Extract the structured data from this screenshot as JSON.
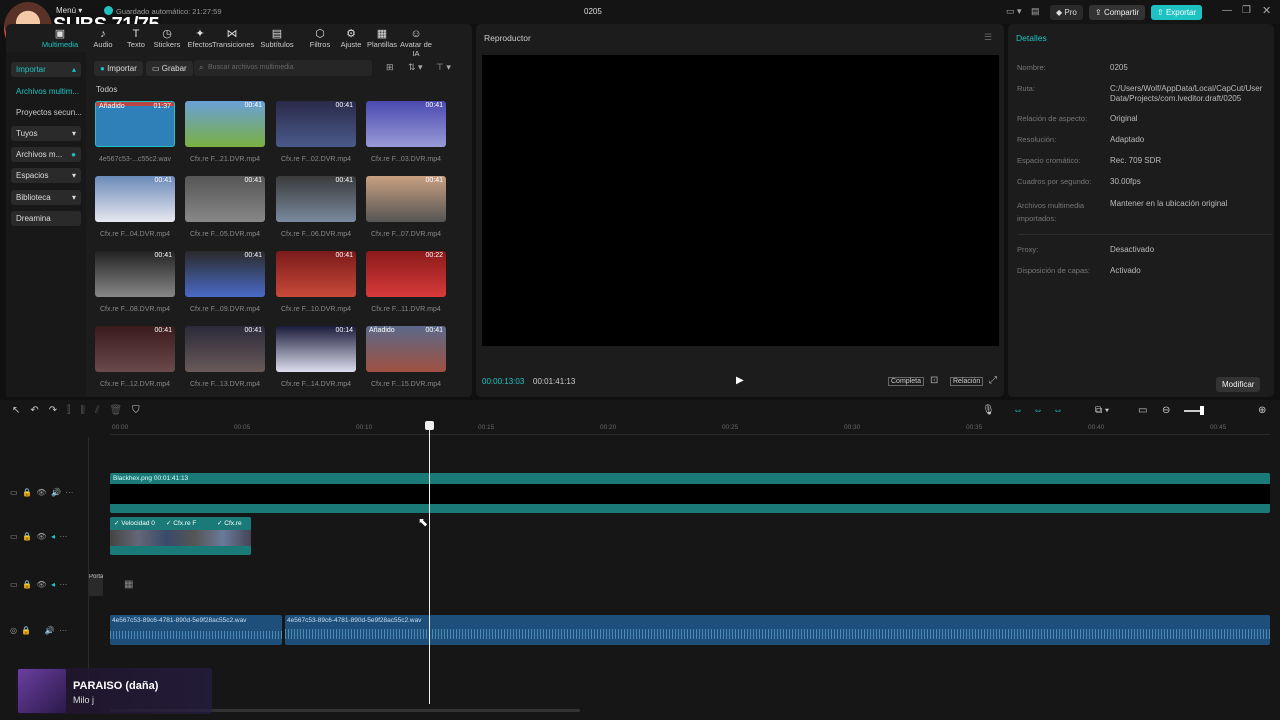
{
  "overlay": {
    "subs": "SUBS 71/75",
    "song_title": "PARAISO (daña)",
    "song_artist": "Milo j"
  },
  "titlebar": {
    "menu": "Menú",
    "autosave": "Guardado automático: 21:27:59",
    "project": "0205",
    "pro": "Pro",
    "share": "Compartir",
    "export": "Exportar"
  },
  "toolbar": [
    {
      "label": "Multimedia",
      "icon": "media-icon"
    },
    {
      "label": "Audio",
      "icon": "audio-icon"
    },
    {
      "label": "Texto",
      "icon": "text-icon"
    },
    {
      "label": "Stickers",
      "icon": "sticker-icon"
    },
    {
      "label": "Efectos",
      "icon": "effects-icon"
    },
    {
      "label": "Transiciones",
      "icon": "transition-icon"
    },
    {
      "label": "Subtítulos",
      "icon": "subtitles-icon"
    },
    {
      "label": "Filtros",
      "icon": "filters-icon"
    },
    {
      "label": "Ajuste",
      "icon": "adjust-icon"
    },
    {
      "label": "Plantillas",
      "icon": "templates-icon"
    },
    {
      "label": "Avatar de IA",
      "icon": "avatar-icon"
    }
  ],
  "sidebar": {
    "items": [
      "Importar",
      "Archivos multim...",
      "Proyectos secun...",
      "Tuyos",
      "Archivos m...",
      "Espacios",
      "Biblioteca",
      "Dreamina"
    ]
  },
  "media": {
    "import_btn": "Importar",
    "record_btn": "Grabar",
    "search_placeholder": "Buscar archivos multimedia",
    "section": "Todos",
    "items": [
      {
        "name": "4e567c53-...c55c2.wav",
        "duration": "01:37",
        "badge": "Añadido"
      },
      {
        "name": "Cfx.re F...21.DVR.mp4",
        "duration": "00:41",
        "badge": ""
      },
      {
        "name": "Cfx.re F...02.DVR.mp4",
        "duration": "00:41",
        "badge": ""
      },
      {
        "name": "Cfx.re F...03.DVR.mp4",
        "duration": "00:41",
        "badge": ""
      },
      {
        "name": "Cfx.re F...04.DVR.mp4",
        "duration": "00:41",
        "badge": ""
      },
      {
        "name": "Cfx.re F...05.DVR.mp4",
        "duration": "00:41",
        "badge": ""
      },
      {
        "name": "Cfx.re F...06.DVR.mp4",
        "duration": "00:41",
        "badge": ""
      },
      {
        "name": "Cfx.re F...07.DVR.mp4",
        "duration": "00:41",
        "badge": ""
      },
      {
        "name": "Cfx.re F...08.DVR.mp4",
        "duration": "00:41",
        "badge": ""
      },
      {
        "name": "Cfx.re F...09.DVR.mp4",
        "duration": "00:41",
        "badge": ""
      },
      {
        "name": "Cfx.re F...10.DVR.mp4",
        "duration": "00:41",
        "badge": ""
      },
      {
        "name": "Cfx.re F...11.DVR.mp4",
        "duration": "00:22",
        "badge": ""
      },
      {
        "name": "Cfx.re F...12.DVR.mp4",
        "duration": "00:41",
        "badge": ""
      },
      {
        "name": "Cfx.re F...13.DVR.mp4",
        "duration": "00:41",
        "badge": ""
      },
      {
        "name": "Cfx.re F...14.DVR.mp4",
        "duration": "00:14",
        "badge": ""
      },
      {
        "name": "Cfx.re F...15.DVR.mp4",
        "duration": "00:41",
        "badge": "Añadido"
      }
    ]
  },
  "player": {
    "title": "Reproductor",
    "current": "00:00:13:03",
    "total": "00:01:41:13",
    "full": "Completa",
    "ratio": "Relación"
  },
  "details": {
    "title": "Detalles",
    "rows": [
      {
        "label": "Nombre:",
        "value": "0205"
      },
      {
        "label": "Ruta:",
        "value": "C:/Users/Wolf/AppData/Local/CapCut/User Data/Projects/com.lveditor.draft/0205"
      },
      {
        "label": "Relación de aspecto:",
        "value": "Original"
      },
      {
        "label": "Resolución:",
        "value": "Adaptado"
      },
      {
        "label": "Espacio cromático:",
        "value": "Rec. 709 SDR"
      },
      {
        "label": "Cuadros por segundo:",
        "value": "30.00fps"
      },
      {
        "label": "Archivos multimedia importados:",
        "value": "Mantener en la ubicación original"
      },
      {
        "label": "Proxy:",
        "value": "Desactivado"
      },
      {
        "label": "Disposición de capas:",
        "value": "Activado"
      }
    ],
    "modify": "Modificar"
  },
  "timeline": {
    "ticks": [
      "00:00",
      "00:05",
      "00:10",
      "00:15",
      "00:20",
      "00:25",
      "00:30",
      "00:35",
      "00:40",
      "00:45"
    ],
    "clip_black": "Blackhex.png  00:01:41:13",
    "clips_video": [
      "Velocidad 0",
      "Cfx.re F",
      "Cfx.re"
    ],
    "audio1": "4e567c53-89c6-4781-890d-5e9f28ac55c2.wav",
    "audio2": "4e567c53-89c6-4781-890d-5e9f28ac55c2.wav",
    "cover": "Portada"
  },
  "colors": {
    "accent": "#1fc2c2",
    "bg": "#101010",
    "panel": "#1c1c1c"
  }
}
